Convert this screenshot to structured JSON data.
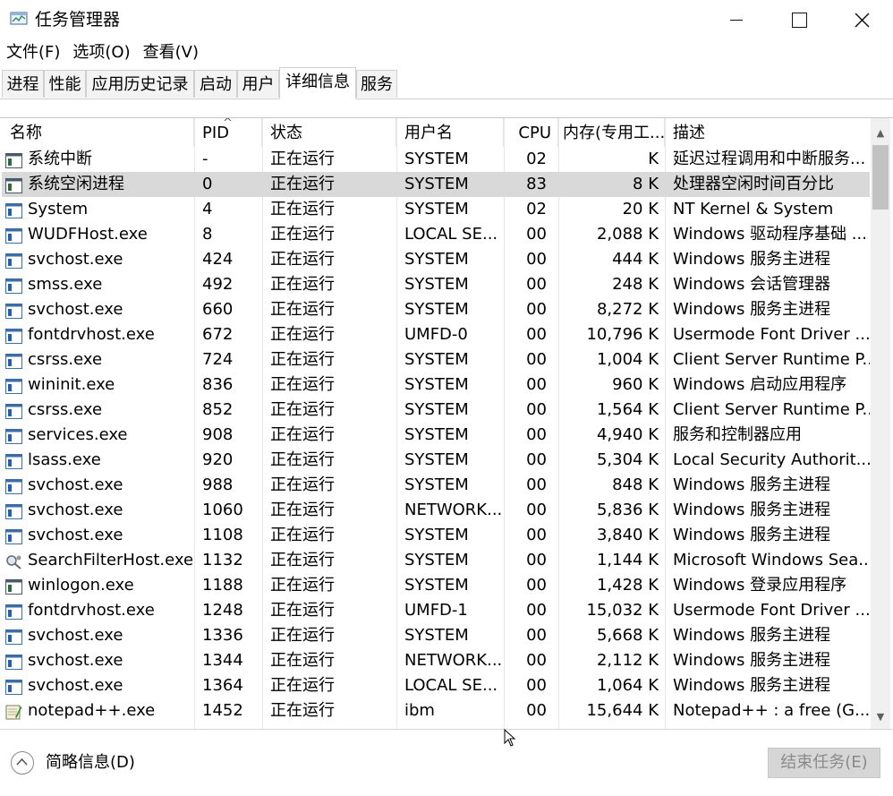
{
  "window": {
    "title": "任务管理器"
  },
  "menu": [
    "文件(F)",
    "选项(O)",
    "查看(V)"
  ],
  "tabs": [
    "进程",
    "性能",
    "应用历史记录",
    "启动",
    "用户",
    "详细信息",
    "服务"
  ],
  "active_tab": "详细信息",
  "columns": [
    "名称",
    "PID",
    "状态",
    "用户名",
    "CPU",
    "内存(专用工...",
    "描述"
  ],
  "rows": [
    {
      "name": "系统中断",
      "pid": "-",
      "status": "正在运行",
      "user": "SYSTEM",
      "cpu": "02",
      "mem": "K",
      "desc": "延迟过程调用和中断服务...",
      "icon": "system-window-icon"
    },
    {
      "name": "系统空闲进程",
      "pid": "0",
      "status": "正在运行",
      "user": "SYSTEM",
      "cpu": "83",
      "mem": "8 K",
      "desc": "处理器空闲时间百分比",
      "icon": "system-window-icon",
      "selected": true
    },
    {
      "name": "System",
      "pid": "4",
      "status": "正在运行",
      "user": "SYSTEM",
      "cpu": "02",
      "mem": "20 K",
      "desc": "NT Kernel & System",
      "icon": "app-window-icon"
    },
    {
      "name": "WUDFHost.exe",
      "pid": "8",
      "status": "正在运行",
      "user": "LOCAL SE...",
      "cpu": "00",
      "mem": "2,088 K",
      "desc": "Windows 驱动程序基础 ...",
      "icon": "app-window-icon"
    },
    {
      "name": "svchost.exe",
      "pid": "424",
      "status": "正在运行",
      "user": "SYSTEM",
      "cpu": "00",
      "mem": "444 K",
      "desc": "Windows 服务主进程",
      "icon": "app-window-icon"
    },
    {
      "name": "smss.exe",
      "pid": "492",
      "status": "正在运行",
      "user": "SYSTEM",
      "cpu": "00",
      "mem": "248 K",
      "desc": "Windows 会话管理器",
      "icon": "app-window-icon"
    },
    {
      "name": "svchost.exe",
      "pid": "660",
      "status": "正在运行",
      "user": "SYSTEM",
      "cpu": "00",
      "mem": "8,272 K",
      "desc": "Windows 服务主进程",
      "icon": "app-window-icon"
    },
    {
      "name": "fontdrvhost.exe",
      "pid": "672",
      "status": "正在运行",
      "user": "UMFD-0",
      "cpu": "00",
      "mem": "10,796 K",
      "desc": "Usermode Font Driver ...",
      "icon": "app-window-icon"
    },
    {
      "name": "csrss.exe",
      "pid": "724",
      "status": "正在运行",
      "user": "SYSTEM",
      "cpu": "00",
      "mem": "1,004 K",
      "desc": "Client Server Runtime P...",
      "icon": "app-window-icon"
    },
    {
      "name": "wininit.exe",
      "pid": "836",
      "status": "正在运行",
      "user": "SYSTEM",
      "cpu": "00",
      "mem": "960 K",
      "desc": "Windows 启动应用程序",
      "icon": "app-window-icon"
    },
    {
      "name": "csrss.exe",
      "pid": "852",
      "status": "正在运行",
      "user": "SYSTEM",
      "cpu": "00",
      "mem": "1,564 K",
      "desc": "Client Server Runtime P...",
      "icon": "app-window-icon"
    },
    {
      "name": "services.exe",
      "pid": "908",
      "status": "正在运行",
      "user": "SYSTEM",
      "cpu": "00",
      "mem": "4,940 K",
      "desc": "服务和控制器应用",
      "icon": "app-window-icon"
    },
    {
      "name": "lsass.exe",
      "pid": "920",
      "status": "正在运行",
      "user": "SYSTEM",
      "cpu": "00",
      "mem": "5,304 K",
      "desc": "Local Security Authorit...",
      "icon": "app-window-icon"
    },
    {
      "name": "svchost.exe",
      "pid": "988",
      "status": "正在运行",
      "user": "SYSTEM",
      "cpu": "00",
      "mem": "848 K",
      "desc": "Windows 服务主进程",
      "icon": "app-window-icon"
    },
    {
      "name": "svchost.exe",
      "pid": "1060",
      "status": "正在运行",
      "user": "NETWORK...",
      "cpu": "00",
      "mem": "5,836 K",
      "desc": "Windows 服务主进程",
      "icon": "app-window-icon"
    },
    {
      "name": "svchost.exe",
      "pid": "1108",
      "status": "正在运行",
      "user": "SYSTEM",
      "cpu": "00",
      "mem": "3,840 K",
      "desc": "Windows 服务主进程",
      "icon": "app-window-icon"
    },
    {
      "name": "SearchFilterHost.exe",
      "pid": "1132",
      "status": "正在运行",
      "user": "SYSTEM",
      "cpu": "00",
      "mem": "1,144 K",
      "desc": "Microsoft Windows Sea...",
      "icon": "search-filter-icon"
    },
    {
      "name": "winlogon.exe",
      "pid": "1188",
      "status": "正在运行",
      "user": "SYSTEM",
      "cpu": "00",
      "mem": "1,428 K",
      "desc": "Windows 登录应用程序",
      "icon": "system-window-icon"
    },
    {
      "name": "fontdrvhost.exe",
      "pid": "1248",
      "status": "正在运行",
      "user": "UMFD-1",
      "cpu": "00",
      "mem": "15,032 K",
      "desc": "Usermode Font Driver ...",
      "icon": "app-window-icon"
    },
    {
      "name": "svchost.exe",
      "pid": "1336",
      "status": "正在运行",
      "user": "SYSTEM",
      "cpu": "00",
      "mem": "5,668 K",
      "desc": "Windows 服务主进程",
      "icon": "app-window-icon"
    },
    {
      "name": "svchost.exe",
      "pid": "1344",
      "status": "正在运行",
      "user": "NETWORK...",
      "cpu": "00",
      "mem": "2,112 K",
      "desc": "Windows 服务主进程",
      "icon": "app-window-icon"
    },
    {
      "name": "svchost.exe",
      "pid": "1364",
      "status": "正在运行",
      "user": "LOCAL SE...",
      "cpu": "00",
      "mem": "1,064 K",
      "desc": "Windows 服务主进程",
      "icon": "app-window-icon"
    },
    {
      "name": "notepad++.exe",
      "pid": "1452",
      "status": "正在运行",
      "user": "ibm",
      "cpu": "00",
      "mem": "15,644 K",
      "desc": "Notepad++ : a free (G...",
      "icon": "notepad-icon"
    }
  ],
  "footer": {
    "brief": "简略信息(D)",
    "end_task": "结束任务(E)"
  },
  "colors": {
    "selected_row": "#d9d9d9",
    "disabled_button": "#d6d6d6",
    "icon_blue": "#1f5fbf"
  }
}
